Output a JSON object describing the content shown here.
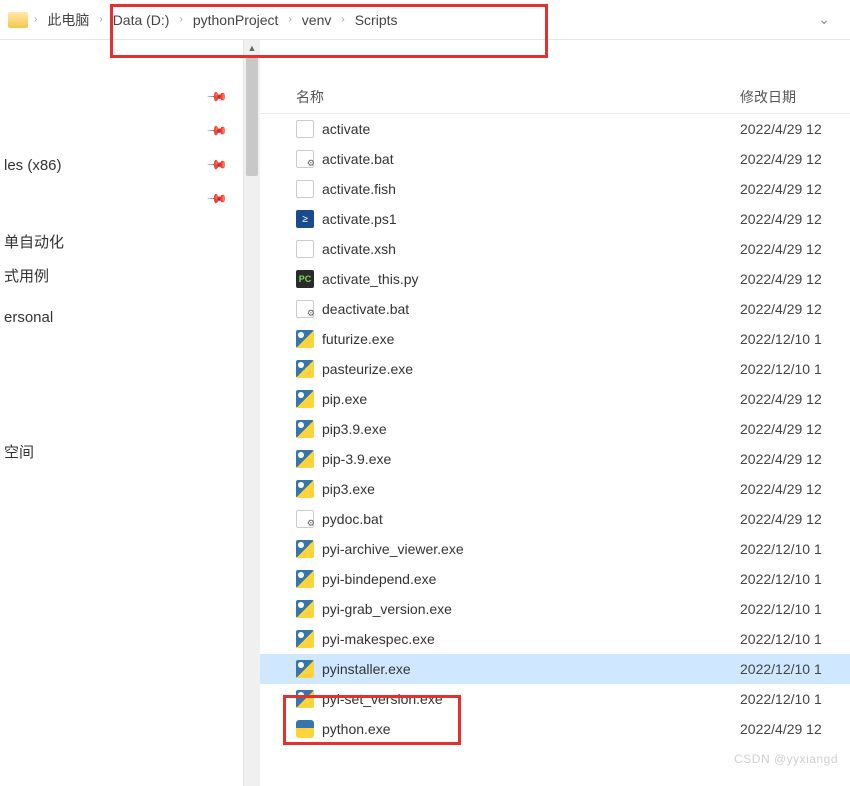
{
  "breadcrumb": {
    "items": [
      {
        "label": "此电脑"
      },
      {
        "label": "Data (D:)"
      },
      {
        "label": "pythonProject"
      },
      {
        "label": "venv"
      },
      {
        "label": "Scripts"
      }
    ]
  },
  "sidebar": {
    "items": [
      {
        "label": "",
        "pin": true
      },
      {
        "label": "",
        "pin": true
      },
      {
        "label": "les (x86)",
        "pin": true
      },
      {
        "label": "",
        "pin": true
      },
      {
        "label": "单自动化",
        "pin": false
      },
      {
        "label": "式用例",
        "pin": false
      },
      {
        "label": "ersonal",
        "pin": false
      },
      {
        "label": "空间",
        "pin": false
      }
    ]
  },
  "columns": {
    "name": "名称",
    "date": "修改日期"
  },
  "files": [
    {
      "name": "activate",
      "date": "2022/4/29 12",
      "icon": "txt"
    },
    {
      "name": "activate.bat",
      "date": "2022/4/29 12",
      "icon": "bat"
    },
    {
      "name": "activate.fish",
      "date": "2022/4/29 12",
      "icon": "txt"
    },
    {
      "name": "activate.ps1",
      "date": "2022/4/29 12",
      "icon": "ps1"
    },
    {
      "name": "activate.xsh",
      "date": "2022/4/29 12",
      "icon": "txt"
    },
    {
      "name": "activate_this.py",
      "date": "2022/4/29 12",
      "icon": "pc"
    },
    {
      "name": "deactivate.bat",
      "date": "2022/4/29 12",
      "icon": "bat"
    },
    {
      "name": "futurize.exe",
      "date": "2022/12/10 1",
      "icon": "exe-py"
    },
    {
      "name": "pasteurize.exe",
      "date": "2022/12/10 1",
      "icon": "exe-py"
    },
    {
      "name": "pip.exe",
      "date": "2022/4/29 12",
      "icon": "exe-py"
    },
    {
      "name": "pip3.9.exe",
      "date": "2022/4/29 12",
      "icon": "exe-py"
    },
    {
      "name": "pip-3.9.exe",
      "date": "2022/4/29 12",
      "icon": "exe-py"
    },
    {
      "name": "pip3.exe",
      "date": "2022/4/29 12",
      "icon": "exe-py"
    },
    {
      "name": "pydoc.bat",
      "date": "2022/4/29 12",
      "icon": "bat"
    },
    {
      "name": "pyi-archive_viewer.exe",
      "date": "2022/12/10 1",
      "icon": "exe-py"
    },
    {
      "name": "pyi-bindepend.exe",
      "date": "2022/12/10 1",
      "icon": "exe-py"
    },
    {
      "name": "pyi-grab_version.exe",
      "date": "2022/12/10 1",
      "icon": "exe-py"
    },
    {
      "name": "pyi-makespec.exe",
      "date": "2022/12/10 1",
      "icon": "exe-py"
    },
    {
      "name": "pyinstaller.exe",
      "date": "2022/12/10 1",
      "icon": "exe-py",
      "selected": true
    },
    {
      "name": "pyi-set_version.exe",
      "date": "2022/12/10 1",
      "icon": "exe-py"
    },
    {
      "name": "python.exe",
      "date": "2022/4/29 12",
      "icon": "python"
    }
  ],
  "watermark": "CSDN @yyxiangd"
}
